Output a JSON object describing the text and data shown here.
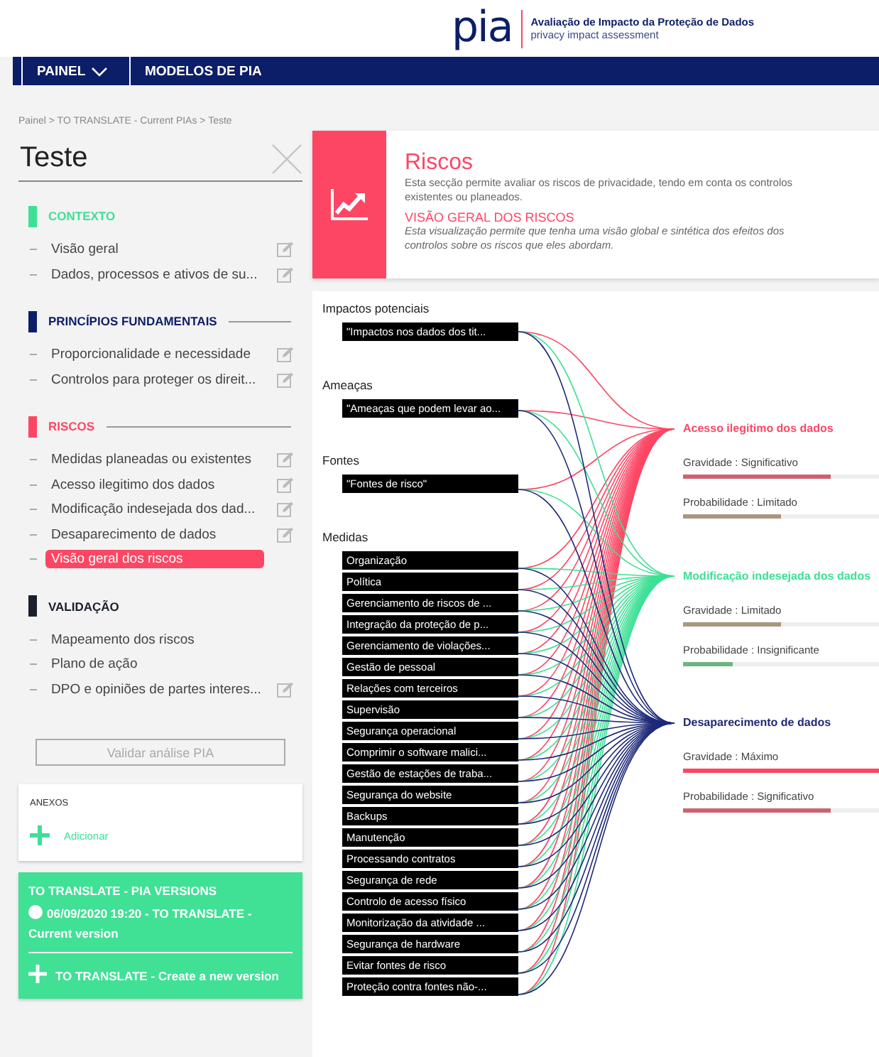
{
  "header": {
    "logo": "pia",
    "title": "Avaliação de Impacto da Proteção de Dados",
    "subtitle": "privacy impact assessment"
  },
  "nav": [
    {
      "label": "PAINEL",
      "dropdown": true
    },
    {
      "label": "MODELOS DE PIA",
      "dropdown": false
    }
  ],
  "breadcrumb": "Painel > TO TRANSLATE - Current PIAs > Teste",
  "sidebar": {
    "title": "Teste",
    "sections": [
      {
        "title": "CONTEXTO",
        "color": "#3ee095",
        "divider": false,
        "items": [
          {
            "label": "Visão geral",
            "editable": true,
            "selected": false
          },
          {
            "label": "Dados, processos e ativos de su...",
            "editable": true,
            "selected": false
          }
        ]
      },
      {
        "title": "PRINCÍPIOS FUNDAMENTAIS",
        "color": "#0c1e68",
        "divider": true,
        "items": [
          {
            "label": "Proporcionalidade e necessidade",
            "editable": true,
            "selected": false
          },
          {
            "label": "Controlos para proteger os direit...",
            "editable": true,
            "selected": false
          }
        ]
      },
      {
        "title": "RISCOS",
        "color": "#fd4664",
        "divider": true,
        "items": [
          {
            "label": "Medidas planeadas ou existentes",
            "editable": true,
            "selected": false
          },
          {
            "label": "Acesso ilegitimo dos dados",
            "editable": true,
            "selected": false
          },
          {
            "label": "Modificação indesejada dos dad...",
            "editable": true,
            "selected": false
          },
          {
            "label": "Desaparecimento de dados",
            "editable": true,
            "selected": false
          },
          {
            "label": "Visão geral dos riscos",
            "editable": false,
            "selected": true
          }
        ]
      },
      {
        "title": "VALIDAÇÃO",
        "color": "#1a1f2b",
        "divider": false,
        "items": [
          {
            "label": "Mapeamento dos riscos",
            "editable": false,
            "selected": false
          },
          {
            "label": "Plano de ação",
            "editable": false,
            "selected": false
          },
          {
            "label": "DPO e opiniões de partes interes...",
            "editable": true,
            "selected": false
          }
        ]
      }
    ],
    "validate_button": {
      "label": "Validar análise PIA",
      "disabled": true
    }
  },
  "attachments": {
    "title": "ANEXOS",
    "add_label": "Adicionar"
  },
  "versions": {
    "title": "TO TRANSLATE - PIA VERSIONS",
    "entries": [
      "06/09/2020 19:20 - TO TRANSLATE - Current version"
    ],
    "create_label": "TO TRANSLATE - Create a new version"
  },
  "section_header": {
    "title": "Riscos",
    "description": "Esta secção permite avaliar os riscos de privacidade, tendo em conta os controlos existentes ou planeados.",
    "subtitle": "VISÃO GERAL DOS RISCOS",
    "subdescription": "Esta visualização permite que tenha uma visão global e sintética dos efeitos dos controlos sobre os riscos que eles abordam."
  },
  "overview": {
    "groups": [
      {
        "title": "Impactos potenciais",
        "items": [
          "\"Impactos nos dados dos tit..."
        ]
      },
      {
        "title": "Ameaças",
        "items": [
          "\"Ameaças que podem levar ao..."
        ]
      },
      {
        "title": "Fontes",
        "items": [
          "\"Fontes de risco\""
        ]
      },
      {
        "title": "Medidas",
        "items": [
          "Organização",
          "Política",
          "Gerenciamento de riscos de ...",
          "Integração da proteção de p...",
          "Gerenciamento de violações...",
          "Gestão de pessoal",
          "Relações com terceiros",
          "Supervisão",
          "Segurança operacional",
          "Comprimir o software malici...",
          "Gestão de estações de traba...",
          "Segurança do website",
          "Backups",
          "Manutenção",
          "Processando contratos",
          "Segurança de rede",
          "Controlo de acesso físico",
          "Monitorização da atividade ...",
          "Segurança de hardware",
          "Evitar fontes de risco",
          "Proteção contra fontes não-..."
        ]
      }
    ],
    "risks": [
      {
        "title": "Acesso ilegitimo dos dados",
        "color": "#fd4664",
        "metrics": [
          {
            "label": "Gravidade : Significativo",
            "level": 0.75,
            "color": "#cc6470"
          },
          {
            "label": "Probabilidade : Limitado",
            "level": 0.5,
            "color": "#a8977f"
          }
        ]
      },
      {
        "title": "Modificação indesejada dos dados",
        "color": "#3ee095",
        "metrics": [
          {
            "label": "Gravidade : Limitado",
            "level": 0.5,
            "color": "#a8977f"
          },
          {
            "label": "Probabilidade : Insignificante",
            "level": 0.25,
            "color": "#6cb57f"
          }
        ]
      },
      {
        "title": "Desaparecimento de dados",
        "color": "#1e2a78",
        "metrics": [
          {
            "label": "Gravidade : Máximo",
            "level": 1,
            "color": "#fd4664"
          },
          {
            "label": "Probabilidade : Significativo",
            "level": 0.75,
            "color": "#cc6470"
          }
        ]
      }
    ]
  }
}
